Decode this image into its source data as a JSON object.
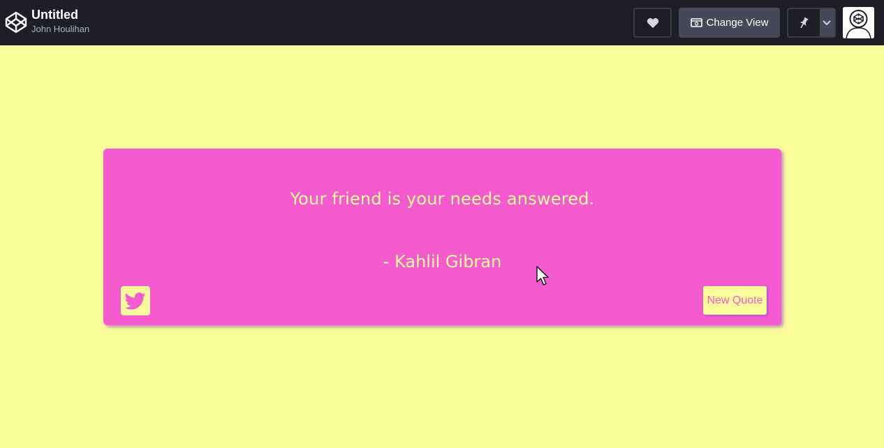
{
  "header": {
    "title": "Untitled",
    "author": "John Houlihan",
    "change_view_label": "Change View",
    "logo_icon": "codepen-logo-icon",
    "heart_icon": "heart-icon",
    "view_icon": "change-view-icon",
    "pin_icon": "pin-icon",
    "caret_icon": "chevron-down-icon",
    "avatar_icon": "codepen-avatar-icon"
  },
  "quote": {
    "text": "Your friend is your needs answered.",
    "author": "- Kahlil Gibran",
    "tweet_icon": "twitter-icon",
    "new_quote_label": "New Quote"
  },
  "colors": {
    "page_background": "#fafd99",
    "card_background": "#f45bcf",
    "header_background": "#1e1f26",
    "accent_text": "#fafd99"
  }
}
